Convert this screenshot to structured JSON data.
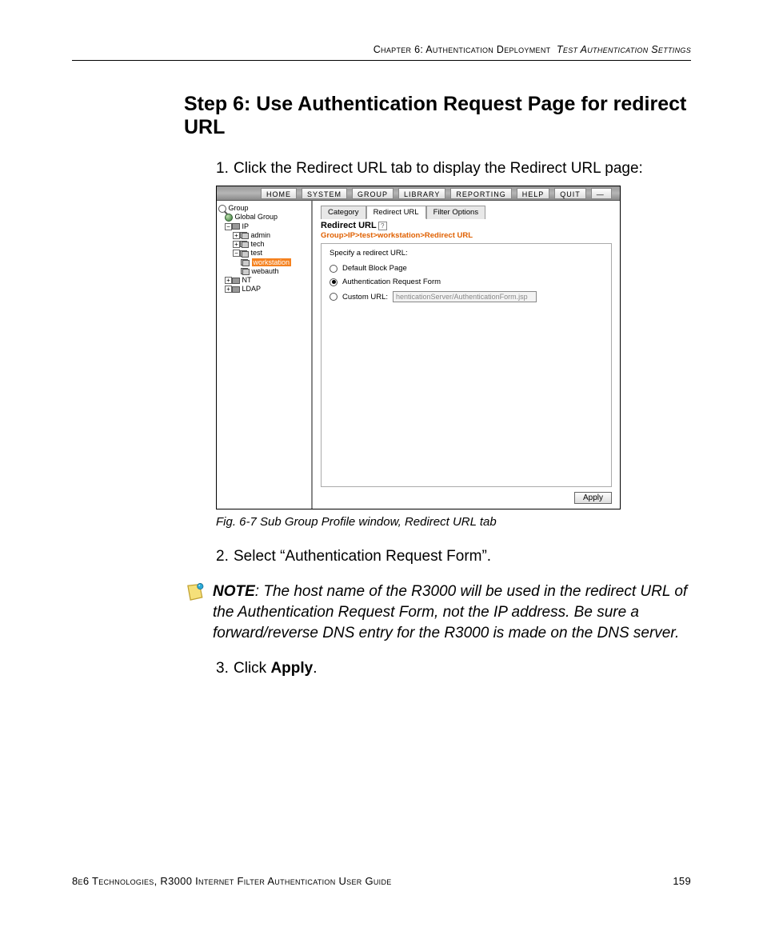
{
  "header": {
    "chapter": "Chapter 6: Authentication Deployment",
    "section": "Test Authentication Settings"
  },
  "heading": "Step 6: Use Authentication Request Page for redirect URL",
  "steps": {
    "s1_num": "1.",
    "s1_text": "Click the Redirect URL tab to display the Redirect URL page:",
    "s2_num": "2.",
    "s2_text": "Select “Authentication Request Form”.",
    "s3_num": "3.",
    "s3_prefix": "Click ",
    "s3_bold": "Apply",
    "s3_suffix": "."
  },
  "caption": "Fig. 6-7  Sub Group Profile window, Redirect URL tab",
  "note": {
    "label": "NOTE",
    "text": ": The host name of the R3000 will be used in the redirect URL of the Authentication Request Form, not the IP address. Be sure a forward/reverse DNS entry for the R3000 is made on the DNS server."
  },
  "footer": {
    "left": "8e6 Technologies, R3000 Internet Filter Authentication User Guide",
    "right": "159"
  },
  "app": {
    "menu": [
      "HOME",
      "SYSTEM",
      "GROUP",
      "LIBRARY",
      "REPORTING",
      "HELP",
      "QUIT",
      "—"
    ],
    "tree": {
      "root": "Group",
      "global": "Global Group",
      "ip": "IP",
      "admin": "admin",
      "tech": "tech",
      "test": "test",
      "workstation": "workstation",
      "webauth": "webauth",
      "nt": "NT",
      "ldap": "LDAP"
    },
    "tabs": {
      "category": "Category",
      "redirect": "Redirect URL",
      "filter": "Filter Options"
    },
    "panel_title": "Redirect URL",
    "breadcrumb": "Group>IP>test>workstation>Redirect URL",
    "form": {
      "specify": "Specify a redirect URL:",
      "opt1": "Default Block Page",
      "opt2": "Authentication Request Form",
      "opt3": "Custom URL:",
      "url_value": "henticationServer/AuthenticationForm.jsp"
    },
    "apply": "Apply"
  }
}
